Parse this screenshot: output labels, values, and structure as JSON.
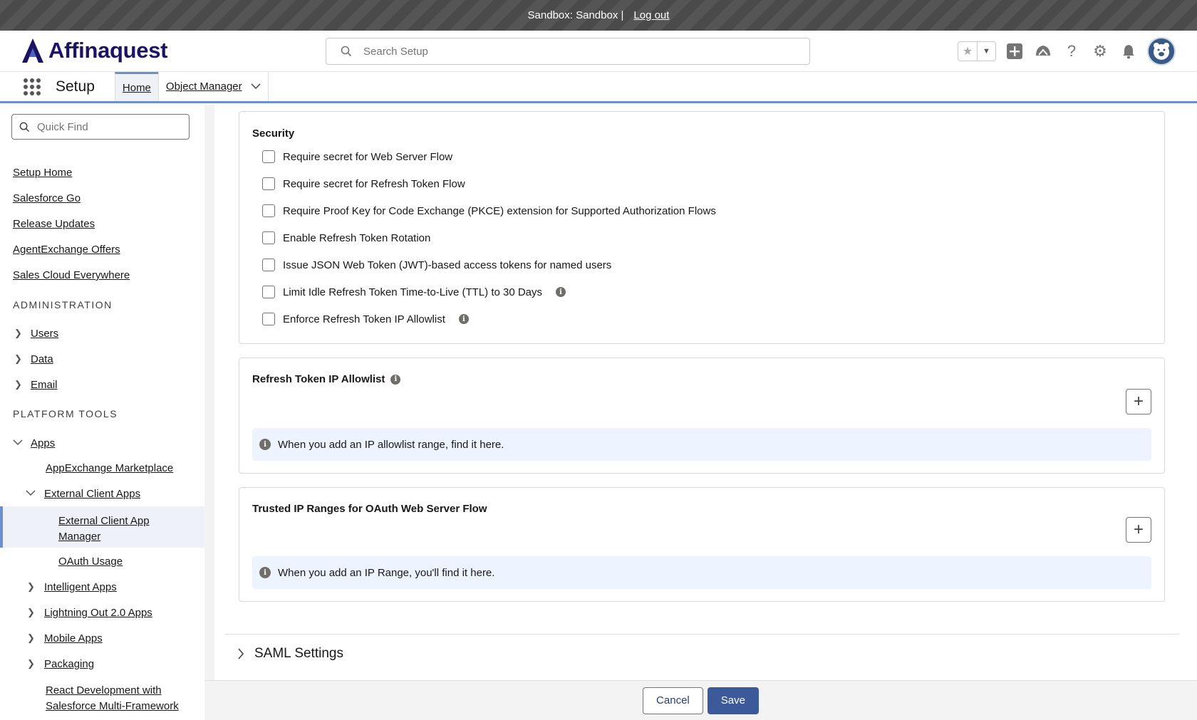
{
  "sandbox_bar": {
    "label": "Sandbox: Sandbox |",
    "logout": "Log out"
  },
  "header": {
    "brand": "Affinaquest",
    "search_placeholder": "Search Setup"
  },
  "app_nav": {
    "app_name": "Setup",
    "tabs": [
      {
        "label": "Home"
      },
      {
        "label": "Object Manager"
      }
    ]
  },
  "sidebar": {
    "quick_find_placeholder": "Quick Find",
    "top_links": [
      "Setup Home",
      "Salesforce Go",
      "Release Updates",
      "AgentExchange Offers",
      "Sales Cloud Everywhere"
    ],
    "admin_heading": "ADMINISTRATION",
    "admin_items": [
      "Users",
      "Data",
      "Email"
    ],
    "platform_heading": "PLATFORM TOOLS",
    "apps": "Apps",
    "appexchange": "AppExchange Marketplace",
    "external_client_apps": "External Client Apps",
    "eca_manager": "External Client App Manager",
    "oauth_usage": "OAuth Usage",
    "more_items": [
      "Intelligent Apps",
      "Lightning Out 2.0 Apps",
      "Mobile Apps",
      "Packaging"
    ],
    "react_dev": "React Development with Salesforce Multi-Framework"
  },
  "security": {
    "title": "Security",
    "options": [
      {
        "label": "Require secret for Web Server Flow",
        "checked": false,
        "info": false
      },
      {
        "label": "Require secret for Refresh Token Flow",
        "checked": false,
        "info": false
      },
      {
        "label": "Require Proof Key for Code Exchange (PKCE) extension for Supported Authorization Flows",
        "checked": false,
        "info": false
      },
      {
        "label": "Enable Refresh Token Rotation",
        "checked": false,
        "info": false
      },
      {
        "label": "Issue JSON Web Token (JWT)-based access tokens for named users",
        "checked": false,
        "info": false
      },
      {
        "label": "Limit Idle Refresh Token Time-to-Live (TTL) to 30 Days",
        "checked": false,
        "info": true
      },
      {
        "label": "Enforce Refresh Token IP Allowlist",
        "checked": false,
        "info": true
      }
    ]
  },
  "allowlist": {
    "title": "Refresh Token IP Allowlist",
    "notice": "When you add an IP allowlist range, find it here."
  },
  "trusted_ranges": {
    "title": "Trusted IP Ranges for OAuth Web Server Flow",
    "notice": "When you add an IP Range, you'll find it here."
  },
  "saml": {
    "label": "SAML Settings"
  },
  "footer": {
    "cancel": "Cancel",
    "save": "Save"
  },
  "colors": {
    "brand": "#1b1464",
    "accent": "#3c5a99",
    "notice_bg": "#eef4ff"
  }
}
